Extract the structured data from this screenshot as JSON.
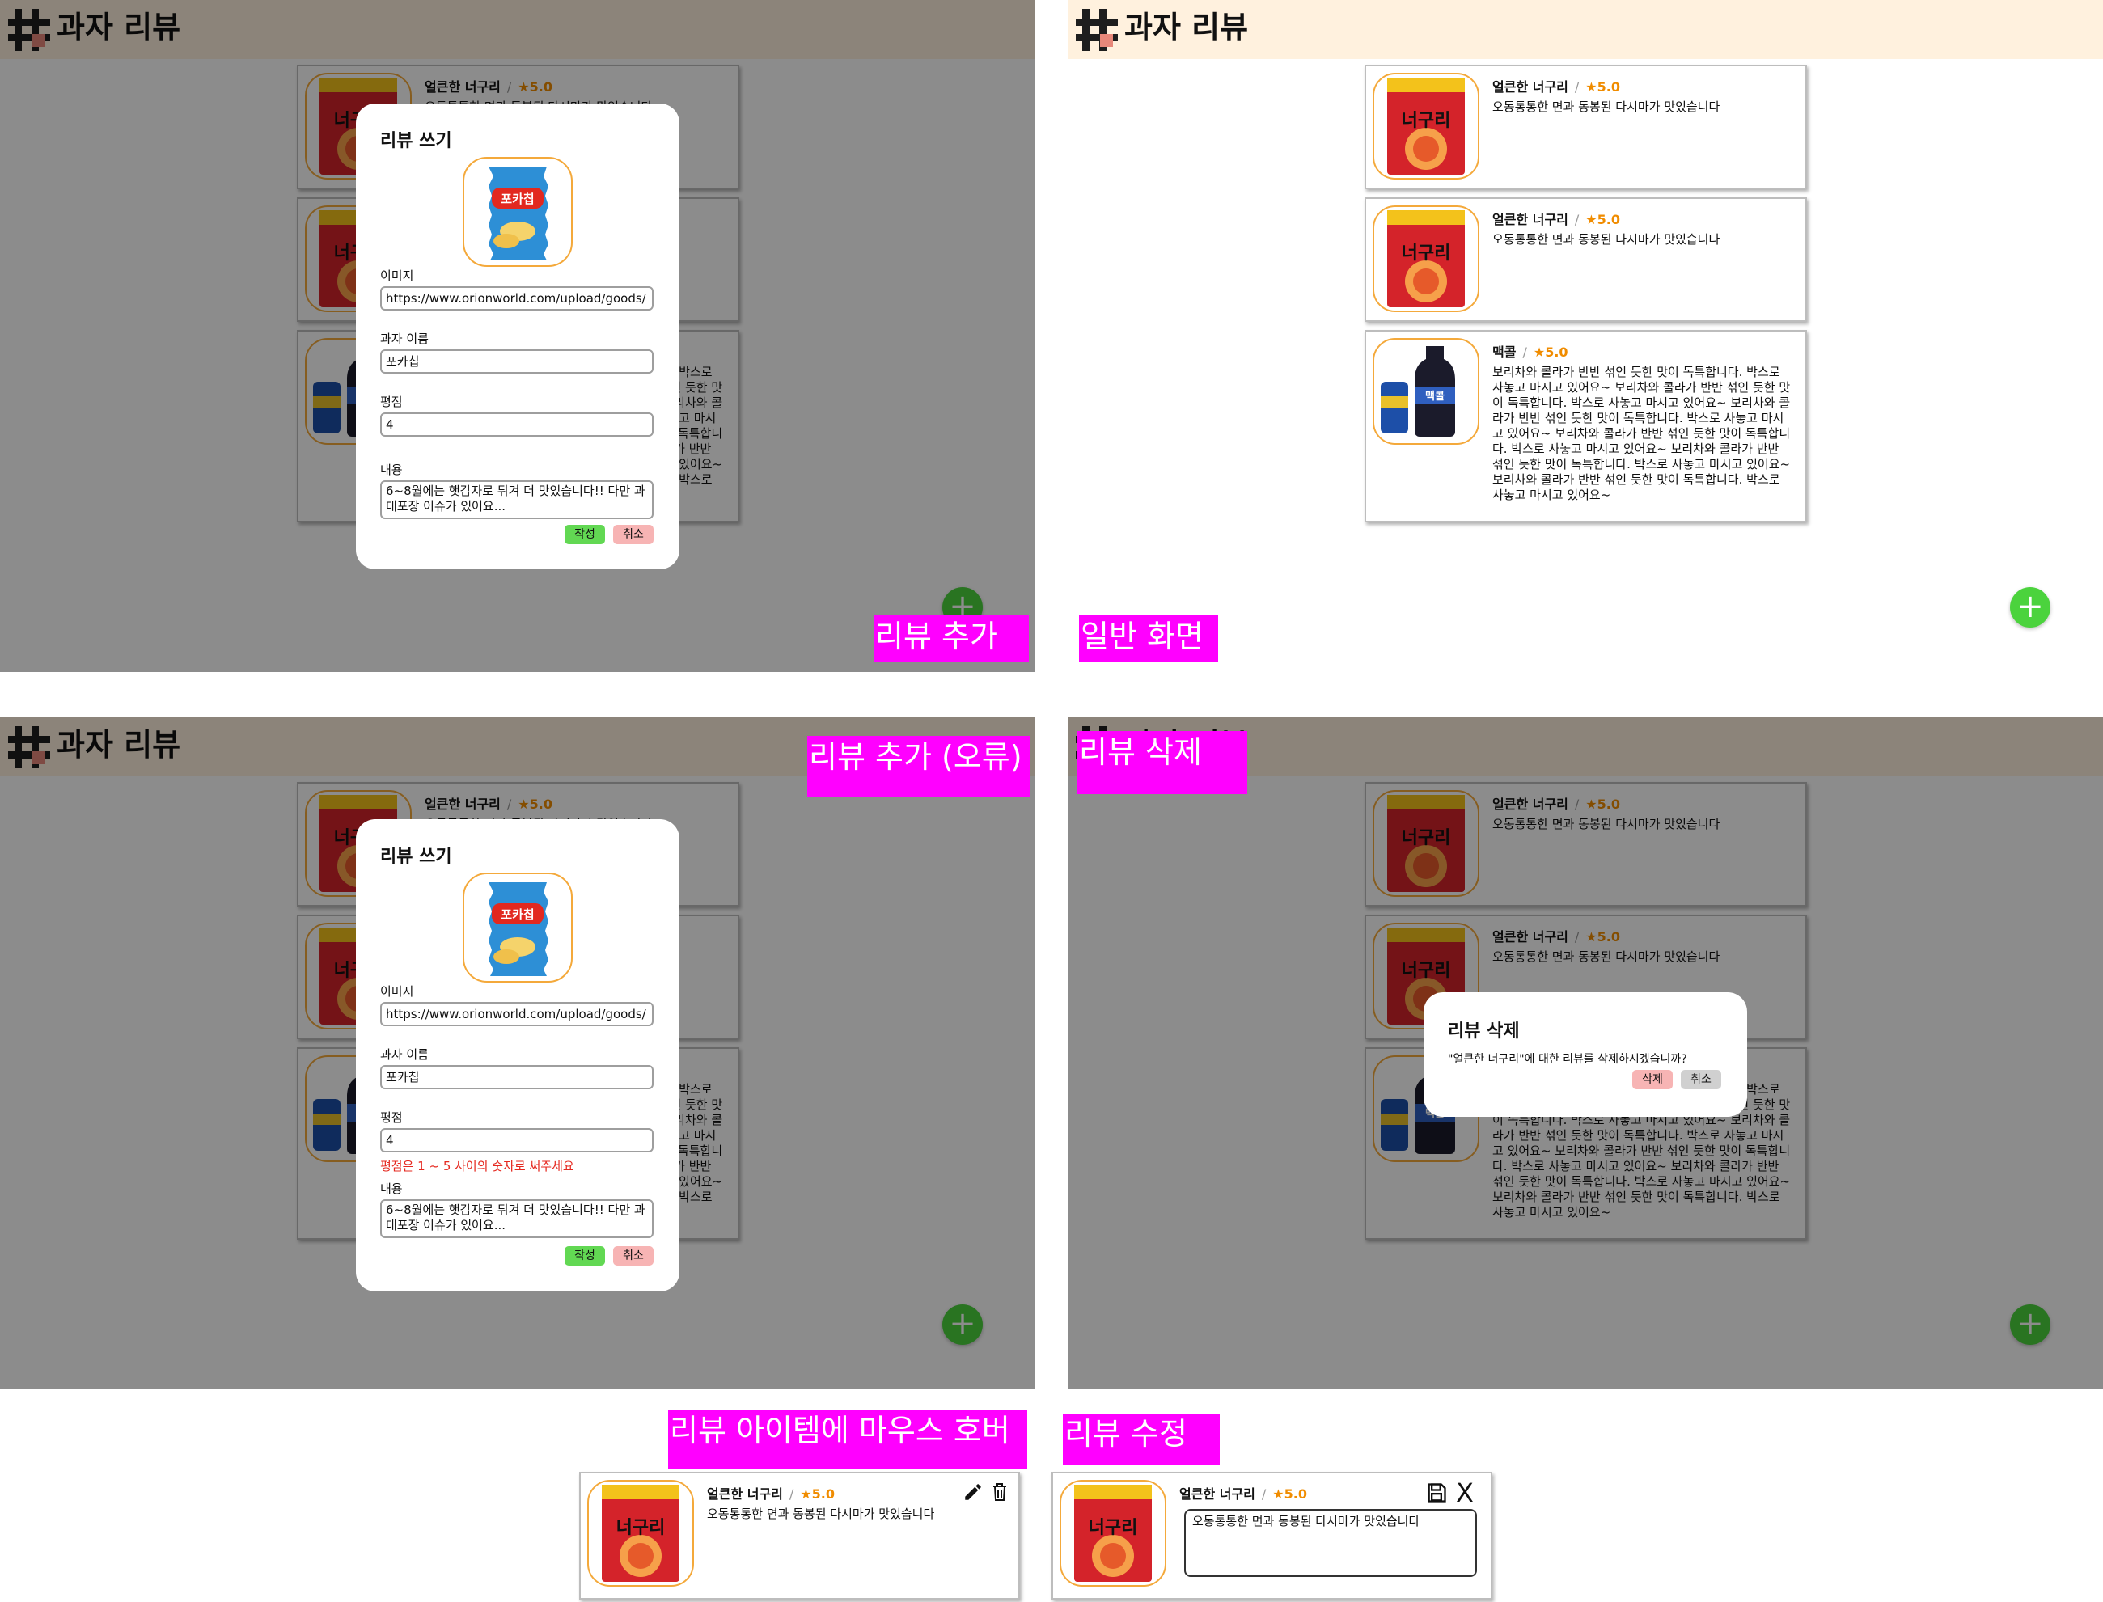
{
  "app": {
    "title": "과자 리뷰"
  },
  "review_items": [
    {
      "name": "얼큰한 너구리",
      "rating": "★5.0",
      "content": "오동통통한 면과 동봉된 다시마가 맛있습니다"
    },
    {
      "name": "얼큰한 너구리",
      "rating": "★5.0",
      "content": "오동통통한 면과 동봉된 다시마가 맛있습니다"
    },
    {
      "name": "맥콜",
      "rating": "★5.0",
      "content": "보리차와 콜라가 반반 섞인 듯한 맛이 독특합니다. 박스로 사놓고 마시고 있어요~ 보리차와 콜라가 반반 섞인 듯한 맛이 독특합니다. 박스로 사놓고 마시고 있어요~ 보리차와 콜라가 반반 섞인 듯한 맛이 독특합니다. 박스로 사놓고 마시고 있어요~ 보리차와 콜라가 반반 섞인 듯한 맛이 독특합니다. 박스로 사놓고 마시고 있어요~ 보리차와 콜라가 반반 섞인 듯한 맛이 독특합니다. 박스로 사놓고 마시고 있어요~ 보리차와 콜라가 반반 섞인 듯한 맛이 독특합니다. 박스로 사놓고 마시고 있어요~"
    }
  ],
  "add_modal": {
    "title": "리뷰 쓰기",
    "image_label": "이미지",
    "image_value": "https://www.orionworld.com/upload/goods/",
    "name_label": "과자 이름",
    "name_value": "포카칩",
    "rating_label": "평점",
    "rating_value": "4",
    "content_label": "내용",
    "content_value": "6~8월에는 햇감자로 튀겨 더 맛있습니다!! 다만 과대포장 이슈가 있어요...",
    "error_text": "평점은 1 ~ 5 사이의 숫자로 써주세요",
    "submit_label": "작성",
    "cancel_label": "취소"
  },
  "delete_modal": {
    "title": "리뷰 삭제",
    "message": "\"얼큰한 너구리\"에 대한 리뷰를 삭제하시겠습니까?",
    "delete_label": "삭제",
    "cancel_label": "취소"
  },
  "captions": {
    "add": "리뷰 추가",
    "normal": "일반 화면",
    "add_error": "리뷰 추가 (오류)",
    "delete": "리뷰 삭제",
    "hover": "리뷰 아이템에 마우스 호버",
    "edit": "리뷰 수정"
  },
  "fab_label": "+",
  "edit_close_label": "X",
  "snack_labels": {
    "pokachip": "포카칩",
    "neoguri": "너구리",
    "mccol": "맥콜"
  },
  "colors": {
    "header_bg": "#fff1de",
    "accent": "#f4a93b",
    "fab": "#4bd33d",
    "star": "#f08c00",
    "caption": "#ff00ff",
    "error": "#e5281f"
  },
  "icons": [
    "pencil-icon",
    "trash-icon",
    "save-icon",
    "close-icon",
    "plus-icon"
  ]
}
